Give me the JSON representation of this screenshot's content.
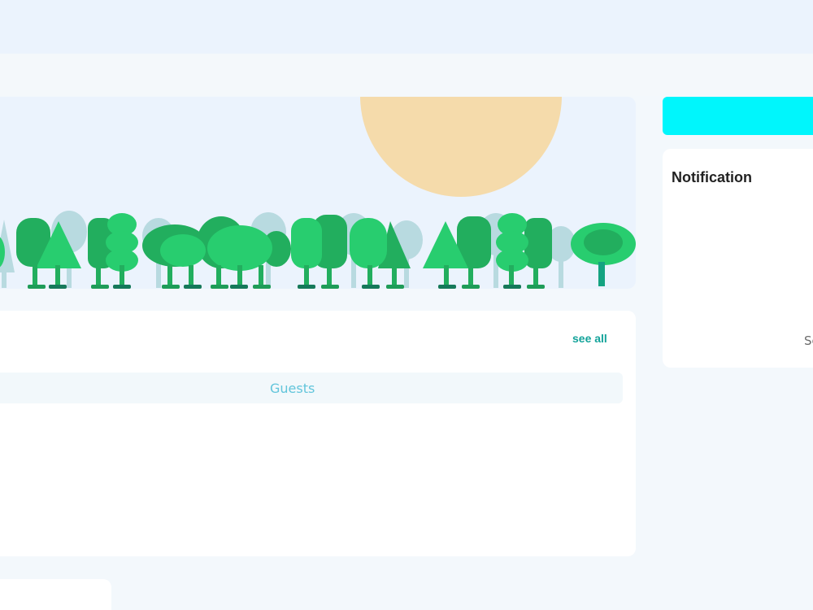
{
  "guests_panel": {
    "see_all_label": "see all",
    "column_header": "Guests"
  },
  "notifications": {
    "title": "Notification",
    "footer_link_partial": "Se"
  },
  "hero": {
    "illustration": "sun-and-forest-illustration",
    "colors": {
      "sky": "#ebf3fd",
      "sun": "#f5dbab",
      "tree_light": "#28cd6f",
      "tree_dark": "#22ae5e",
      "tree_shadow": "#b0d6dc"
    }
  },
  "accent_colors": {
    "primary_button": "#00f6fc",
    "link": "#13a39a",
    "table_header_text": "#62c5db"
  }
}
